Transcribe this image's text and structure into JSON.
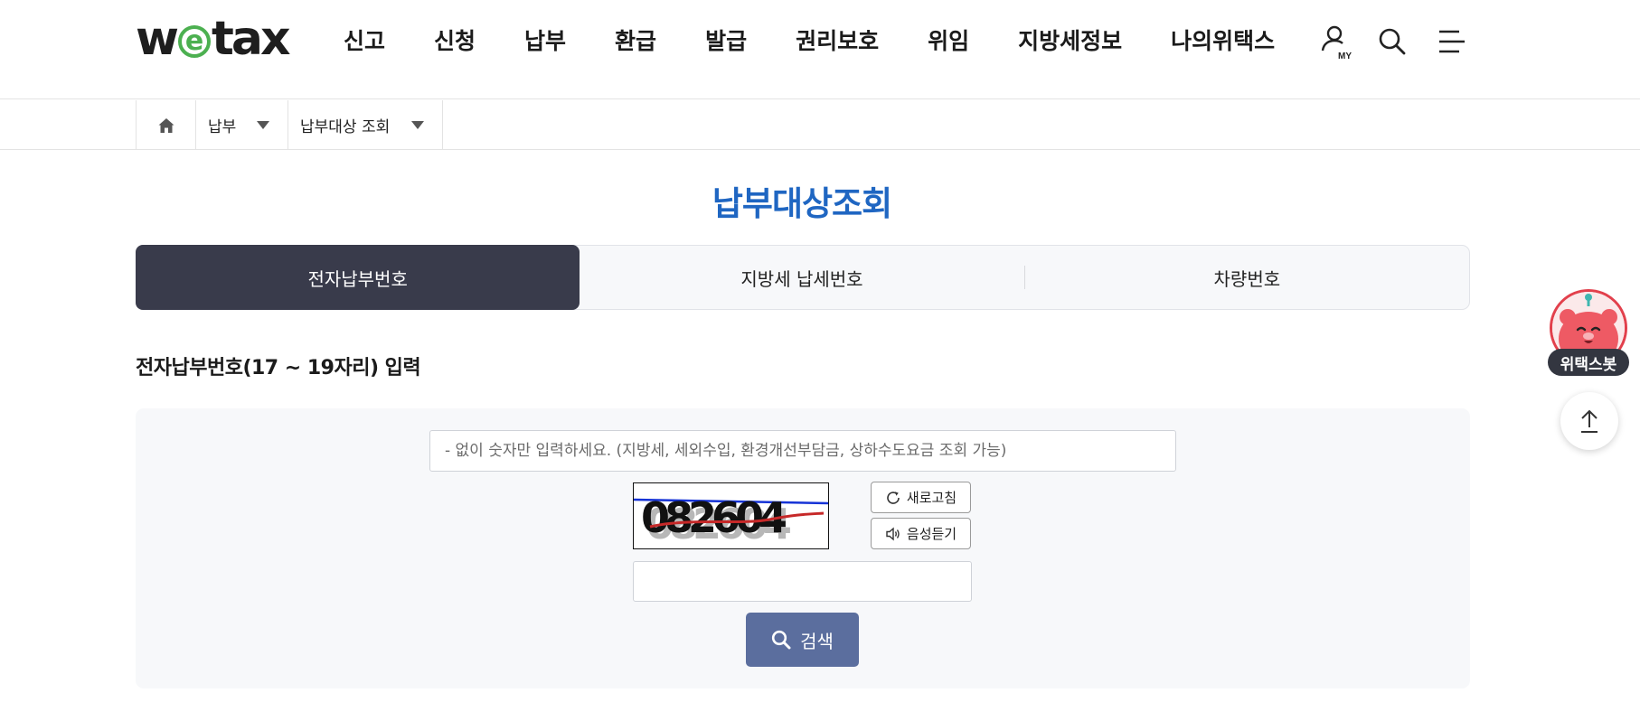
{
  "header": {
    "logo": {
      "part1": "w",
      "part2": "e",
      "part3": "tax"
    },
    "nav": [
      "신고",
      "신청",
      "납부",
      "환급",
      "발급",
      "권리보호",
      "위임",
      "지방세정보",
      "나의위택스"
    ],
    "icons": [
      "my-page-icon",
      "search-icon",
      "menu-icon"
    ],
    "my_badge": "MY"
  },
  "breadcrumb": {
    "home_icon": "home-icon",
    "level1": "납부",
    "level2": "납부대상 조회"
  },
  "page": {
    "title": "납부대상조회"
  },
  "tabs": [
    {
      "label": "전자납부번호",
      "active": true
    },
    {
      "label": "지방세 납세번호",
      "active": false
    },
    {
      "label": "차량번호",
      "active": false
    }
  ],
  "form": {
    "section_label": "전자납부번호(17 ~ 19자리) 입력",
    "epay_number": {
      "value": "",
      "placeholder": "- 없이 숫자만 입력하세요. (지방세, 세외수입, 환경개선부담금, 상하수도요금 조회 가능)"
    },
    "captcha": {
      "image_text": "082604",
      "refresh_label": "새로고침",
      "audio_label": "음성듣기",
      "answer_value": ""
    },
    "search_label": "검색"
  },
  "floating": {
    "chatbot_label": "위택스봇",
    "top_icon": "arrow-up-icon"
  },
  "colors": {
    "brand_green": "#4cb050",
    "title_blue": "#1f66c2",
    "active_tab": "#393b4b",
    "search_button": "#5b6e9e",
    "chatbot_red": "#e2404c"
  }
}
